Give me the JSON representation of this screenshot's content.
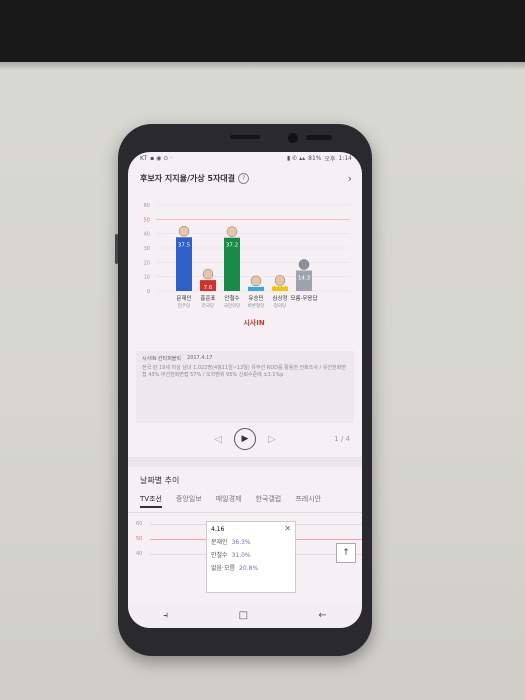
{
  "statusbar": {
    "left": "KT",
    "battery": "81%",
    "ampm": "오후",
    "time": "1:14"
  },
  "header": {
    "title": "후보자 지지율/가상 5자대결",
    "help": "?"
  },
  "chart_data": {
    "type": "bar",
    "categories": [
      "문재인",
      "홍준표",
      "안철수",
      "유승민",
      "심상정",
      "모름·무응답"
    ],
    "parties": [
      "민주당",
      "한국당",
      "국민의당",
      "바른정당",
      "정의당",
      ""
    ],
    "values": [
      37.5,
      7.6,
      37.2,
      2.9,
      3.2,
      14.3
    ],
    "value_labels": [
      "37.5",
      "7.6",
      "37.2",
      "2.9",
      "3.2",
      "14.3"
    ],
    "colors": [
      "#2f5fc9",
      "#d0312d",
      "#1a8a48",
      "#3aa8d8",
      "#f1c40f",
      "#9fa3ad"
    ],
    "yticks": [
      0,
      10,
      20,
      30,
      40,
      50,
      60
    ],
    "ylim": [
      0,
      60
    ],
    "reference_line": 50,
    "brand": "시사IN"
  },
  "source": {
    "label": "시사IN·칸타퍼블릭",
    "date": "2017.4.17",
    "desc": "전국 만 19세 이상 남녀 1,022명(4월11일~12일) 유무선 RDD를 활용한 전화조사 / 유선전화면접 43% 무선전화면접 57% / 오차범위 95% 신뢰수준에 ±3.1%p"
  },
  "player": {
    "prev": "◁",
    "play": "▶",
    "next": "▷",
    "pager": "1 / 4"
  },
  "trend": {
    "title": "날짜별 추이",
    "tabs": [
      "TV조선",
      "중앙일보",
      "매일경제",
      "한국갤럽",
      "프레시안"
    ],
    "active_tab": 0,
    "axis": [
      "60",
      "50",
      "40"
    ],
    "tooltip": {
      "date": "4.16",
      "rows": [
        {
          "name": "문재인",
          "value": "36.3%"
        },
        {
          "name": "안철수",
          "value": "31.0%"
        },
        {
          "name": "없음·모름",
          "value": "20.8%"
        }
      ]
    },
    "top_button": "↑"
  },
  "navbar": {
    "recent": "⫞",
    "home": "□",
    "back": "←"
  }
}
